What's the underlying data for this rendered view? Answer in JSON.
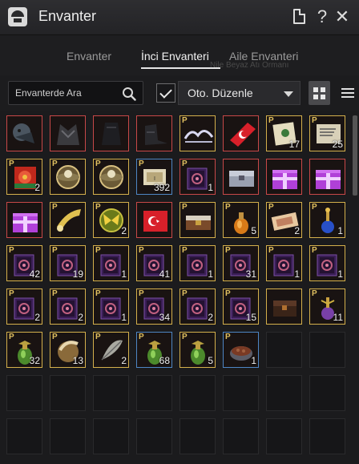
{
  "window": {
    "title": "Envanter"
  },
  "titlebar": {
    "help_glyph": "?",
    "close_glyph": "✕"
  },
  "tabs": [
    {
      "label": "Envanter",
      "active": false
    },
    {
      "label": "İnci Envanteri",
      "active": true
    },
    {
      "label": "Aile Envanteri",
      "active": false
    }
  ],
  "ghost_text": "Nile Beyaz Atı Ormanı",
  "search": {
    "placeholder": "Envanterde Ara",
    "value": ""
  },
  "auto_sort": {
    "checked": true,
    "label": "Oto. Düzenle"
  },
  "view_mode": "grid",
  "colors": {
    "rarity_red": "#c84848",
    "rarity_gold": "#d4b04c",
    "rarity_blue": "#4e86c4",
    "rarity_grey": "#585858"
  },
  "slots": [
    {
      "kind": "skull-mount-gear",
      "rarity": "red",
      "qty": ""
    },
    {
      "kind": "dragon-armor",
      "rarity": "red",
      "qty": ""
    },
    {
      "kind": "dark-armor",
      "rarity": "red",
      "qty": ""
    },
    {
      "kind": "dark-boots",
      "rarity": "red",
      "qty": ""
    },
    {
      "kind": "white-tiara",
      "rarity": "gold",
      "qty": "",
      "p": true
    },
    {
      "kind": "turkish-flag-paint",
      "rarity": "red",
      "qty": ""
    },
    {
      "kind": "map-scroll",
      "rarity": "gold",
      "qty": "17",
      "p": true
    },
    {
      "kind": "letter-scroll",
      "rarity": "gold",
      "qty": "25",
      "p": true
    },
    {
      "kind": "red-flower-box",
      "rarity": "gold",
      "qty": "2",
      "p": true
    },
    {
      "kind": "cage-orb",
      "rarity": "gold",
      "qty": "",
      "p": true
    },
    {
      "kind": "cage-orb",
      "rarity": "gold",
      "qty": "",
      "p": true
    },
    {
      "kind": "scroll-coupon",
      "rarity": "blue",
      "qty": "392",
      "p": true
    },
    {
      "kind": "purple-book",
      "rarity": "red",
      "qty": "1",
      "p": true
    },
    {
      "kind": "silver-chest",
      "rarity": "red",
      "qty": ""
    },
    {
      "kind": "purple-gift",
      "rarity": "red",
      "qty": ""
    },
    {
      "kind": "purple-gift",
      "rarity": "red",
      "qty": ""
    },
    {
      "kind": "purple-gift",
      "rarity": "red",
      "qty": ""
    },
    {
      "kind": "horn",
      "rarity": "gold",
      "qty": "",
      "p": true
    },
    {
      "kind": "butterfly-coin",
      "rarity": "gold",
      "qty": "2",
      "p": true
    },
    {
      "kind": "turkish-flag",
      "rarity": "red",
      "qty": ""
    },
    {
      "kind": "book-chest",
      "rarity": "gold",
      "qty": "",
      "p": true
    },
    {
      "kind": "orange-potion",
      "rarity": "gold",
      "qty": "5",
      "p": true
    },
    {
      "kind": "voucher",
      "rarity": "gold",
      "qty": "2",
      "p": true
    },
    {
      "kind": "blue-potion",
      "rarity": "gold",
      "qty": "1",
      "p": true
    },
    {
      "kind": "purple-book",
      "rarity": "gold",
      "qty": "42",
      "p": true
    },
    {
      "kind": "purple-book",
      "rarity": "gold",
      "qty": "19",
      "p": true
    },
    {
      "kind": "purple-book",
      "rarity": "gold",
      "qty": "1",
      "p": true
    },
    {
      "kind": "purple-book",
      "rarity": "gold",
      "qty": "41",
      "p": true
    },
    {
      "kind": "purple-book",
      "rarity": "gold",
      "qty": "1",
      "p": true
    },
    {
      "kind": "purple-book",
      "rarity": "gold",
      "qty": "31",
      "p": true
    },
    {
      "kind": "purple-book",
      "rarity": "gold",
      "qty": "1",
      "p": true
    },
    {
      "kind": "purple-book",
      "rarity": "gold",
      "qty": "1",
      "p": true
    },
    {
      "kind": "purple-book",
      "rarity": "gold",
      "qty": "2",
      "p": true
    },
    {
      "kind": "purple-book",
      "rarity": "gold",
      "qty": "2",
      "p": true
    },
    {
      "kind": "purple-book",
      "rarity": "gold",
      "qty": "1",
      "p": true
    },
    {
      "kind": "purple-book",
      "rarity": "gold",
      "qty": "34",
      "p": true
    },
    {
      "kind": "purple-book",
      "rarity": "gold",
      "qty": "2",
      "p": true
    },
    {
      "kind": "purple-book",
      "rarity": "gold",
      "qty": "15",
      "p": true
    },
    {
      "kind": "dark-chest",
      "rarity": "gold",
      "qty": "",
      "p": false
    },
    {
      "kind": "purple-potion",
      "rarity": "gold",
      "qty": "11",
      "p": true
    },
    {
      "kind": "green-elixir",
      "rarity": "gold",
      "qty": "32",
      "p": true
    },
    {
      "kind": "beast-horn",
      "rarity": "gold",
      "qty": "13",
      "p": true
    },
    {
      "kind": "feather",
      "rarity": "gold",
      "qty": "2",
      "p": true
    },
    {
      "kind": "green-elixir",
      "rarity": "blue",
      "qty": "68",
      "p": true
    },
    {
      "kind": "green-elixir",
      "rarity": "gold",
      "qty": "5",
      "p": true
    },
    {
      "kind": "food-bowl",
      "rarity": "blue",
      "qty": "1",
      "p": true
    },
    {
      "kind": "empty"
    },
    {
      "kind": "empty"
    },
    {
      "kind": "empty"
    },
    {
      "kind": "empty"
    },
    {
      "kind": "empty"
    },
    {
      "kind": "empty"
    },
    {
      "kind": "empty"
    },
    {
      "kind": "empty"
    },
    {
      "kind": "empty"
    },
    {
      "kind": "empty"
    },
    {
      "kind": "empty"
    },
    {
      "kind": "empty"
    },
    {
      "kind": "empty"
    },
    {
      "kind": "empty"
    },
    {
      "kind": "empty"
    },
    {
      "kind": "empty"
    },
    {
      "kind": "empty"
    },
    {
      "kind": "empty"
    }
  ]
}
